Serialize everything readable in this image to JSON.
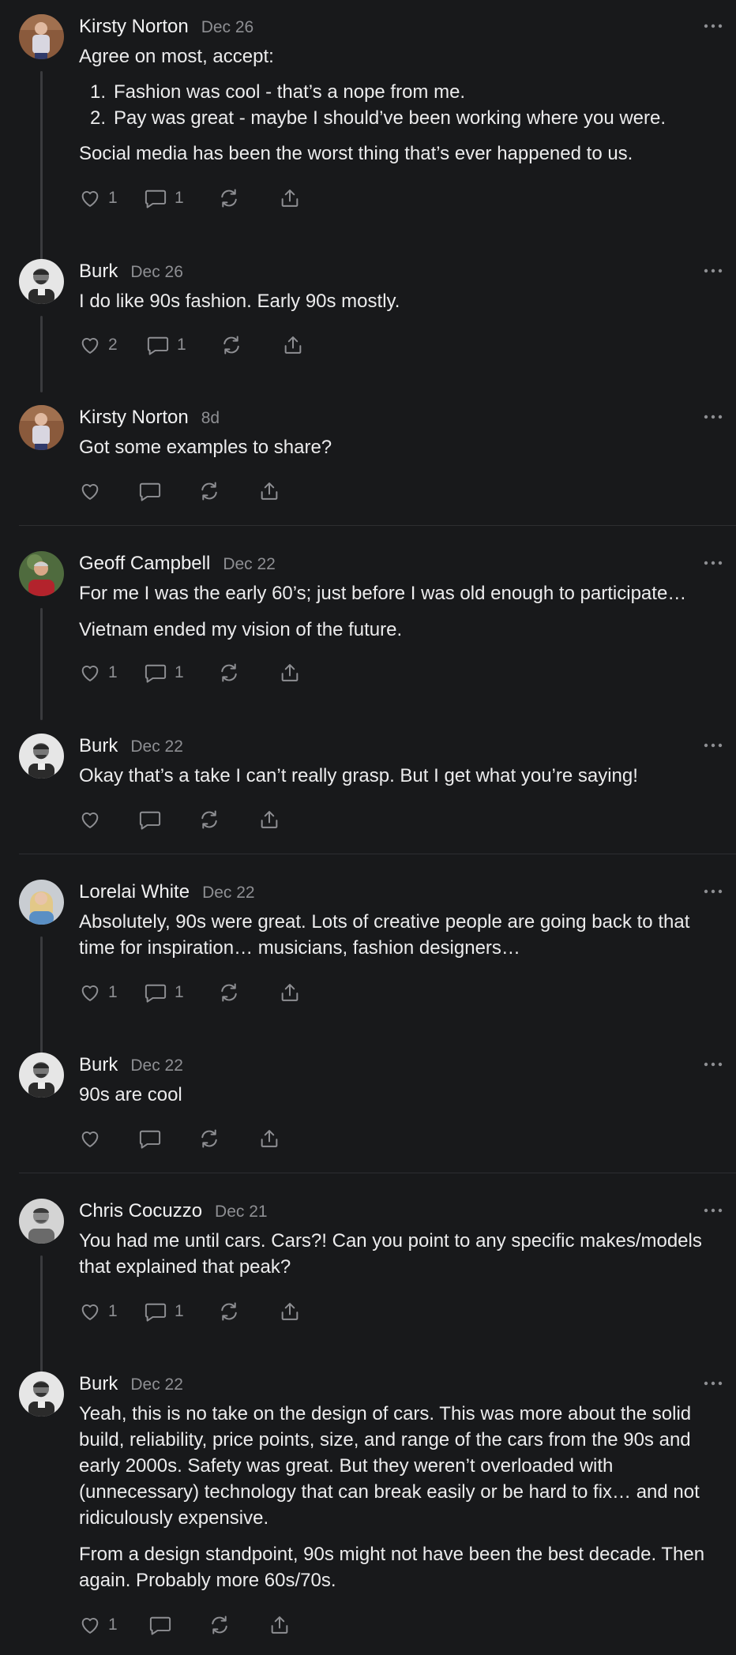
{
  "comments": [
    {
      "id": "c1",
      "author": "Kirsty Norton",
      "date": "Dec 26",
      "paragraph_before": "Agree on most, accept:",
      "list": [
        {
          "num": "1.",
          "text": "Fashion was cool - that’s a nope from me."
        },
        {
          "num": "2.",
          "text": "Pay was great - maybe I should’ve been working where you were."
        }
      ],
      "paragraph_after": "Social media has been the worst thing that’s ever happened to us.",
      "likes": "1",
      "replies": "1"
    },
    {
      "id": "c2",
      "author": "Burk",
      "date": "Dec 26",
      "paragraphs": [
        "I do like 90s fashion. Early 90s mostly."
      ],
      "likes": "2",
      "replies": "1"
    },
    {
      "id": "c3",
      "author": "Kirsty Norton",
      "date": "8d",
      "paragraphs": [
        "Got some examples to share?"
      ],
      "likes": "",
      "replies": ""
    },
    {
      "id": "c4",
      "author": "Geoff Campbell",
      "date": "Dec 22",
      "paragraphs": [
        "For me I was the early 60’s; just before I was old enough to participate…",
        "Vietnam ended my vision of the future."
      ],
      "likes": "1",
      "replies": "1"
    },
    {
      "id": "c5",
      "author": "Burk",
      "date": "Dec 22",
      "paragraphs": [
        "Okay that’s a take I can’t really grasp. But I get what you’re saying!"
      ],
      "likes": "",
      "replies": ""
    },
    {
      "id": "c6",
      "author": "Lorelai White",
      "date": "Dec 22",
      "paragraphs": [
        "Absolutely, 90s were great. Lots of creative people are going back to that time for inspiration… musicians, fashion designers…"
      ],
      "likes": "1",
      "replies": "1"
    },
    {
      "id": "c7",
      "author": "Burk",
      "date": "Dec 22",
      "paragraphs": [
        "90s are cool"
      ],
      "likes": "",
      "replies": ""
    },
    {
      "id": "c8",
      "author": "Chris Cocuzzo",
      "date": "Dec 21",
      "paragraphs": [
        "You had me until cars. Cars?! Can you point to any specific makes/models that explained that peak?"
      ],
      "likes": "1",
      "replies": "1"
    },
    {
      "id": "c9",
      "author": "Burk",
      "date": "Dec 22",
      "paragraphs": [
        "Yeah, this is no take on the design of cars. This was more about the solid build, reliability, price points, size, and range of the cars from the 90s and early 2000s. Safety was great. But they weren’t overloaded with (unnecessary) technology that can break easily or be hard to fix… and not ridiculously expensive.",
        "From a design standpoint, 90s might not have been the best decade. Then again. Probably more 60s/70s."
      ],
      "likes": "1",
      "replies": ""
    }
  ],
  "icons": {
    "like": "heart-icon",
    "reply": "comment-bubble-icon",
    "restack": "restack-icon",
    "share": "share-icon",
    "more": "more-dots-icon"
  },
  "colors": {
    "background": "#18191b",
    "text": "#ececed",
    "muted": "#8e8f93",
    "icon": "#8e8f93"
  }
}
